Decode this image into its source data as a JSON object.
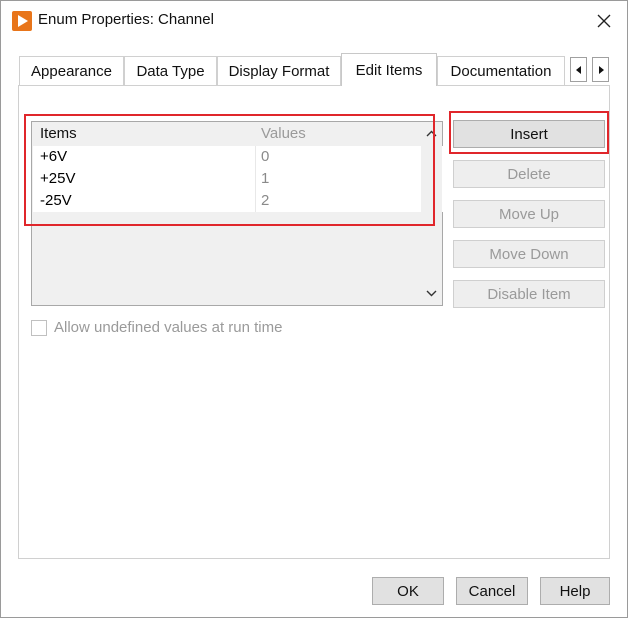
{
  "window": {
    "title": "Enum Properties: Channel",
    "accent_color": "#e8751a"
  },
  "tabs": [
    {
      "label": "Appearance"
    },
    {
      "label": "Data Type"
    },
    {
      "label": "Display Format"
    },
    {
      "label": "Edit Items",
      "active": true
    },
    {
      "label": "Documentation"
    }
  ],
  "list": {
    "header_items": "Items",
    "header_values": "Values",
    "rows": [
      {
        "item": "+6V",
        "value": "0"
      },
      {
        "item": "+25V",
        "value": "1"
      },
      {
        "item": "-25V",
        "value": "2"
      }
    ]
  },
  "buttons": {
    "insert": "Insert",
    "delete": "Delete",
    "move_up": "Move Up",
    "move_down": "Move Down",
    "disable_item": "Disable Item"
  },
  "options": {
    "allow_undefined_label": "Allow undefined values at run time",
    "allow_undefined_checked": false
  },
  "footer": {
    "ok": "OK",
    "cancel": "Cancel",
    "help": "Help"
  },
  "highlight_color": "#e0262b"
}
